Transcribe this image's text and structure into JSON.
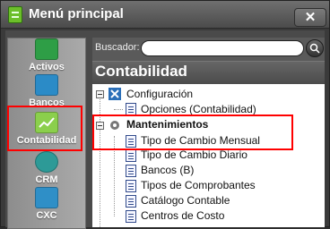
{
  "window": {
    "title": "Menú principal",
    "close_label": "✕",
    "accent": "#ff0000"
  },
  "sidebar": {
    "items": [
      {
        "label": "Activos",
        "icon": "activos-icon",
        "color": "#2e9e46"
      },
      {
        "label": "Bancos",
        "icon": "bancos-icon",
        "color": "#2b8bc7"
      },
      {
        "label": "Contabilidad",
        "icon": "contabilidad-icon",
        "color": "#8bcf4c"
      },
      {
        "label": "CRM",
        "icon": "crm-icon",
        "color": "#2d9a97"
      },
      {
        "label": "CXC",
        "icon": "cxc-icon",
        "color": "#2f8fc7"
      }
    ]
  },
  "search": {
    "label": "Buscador:",
    "placeholder": ""
  },
  "section": {
    "title": "Contabilidad"
  },
  "tree": {
    "configuracion": "Configuración",
    "opciones": "Opciones (Contabilidad)",
    "mantenimientos": "Mantenimientos",
    "tipo_cambio_mensual": "Tipo de Cambio Mensual",
    "tipo_cambio_diario": "Tipo de Cambio Diario",
    "bancos_b": "Bancos (B)",
    "tipos_comprobantes": "Tipos de Comprobantes",
    "catalogo_contable": "Catálogo Contable",
    "centros_costo": "Centros de Costo"
  }
}
